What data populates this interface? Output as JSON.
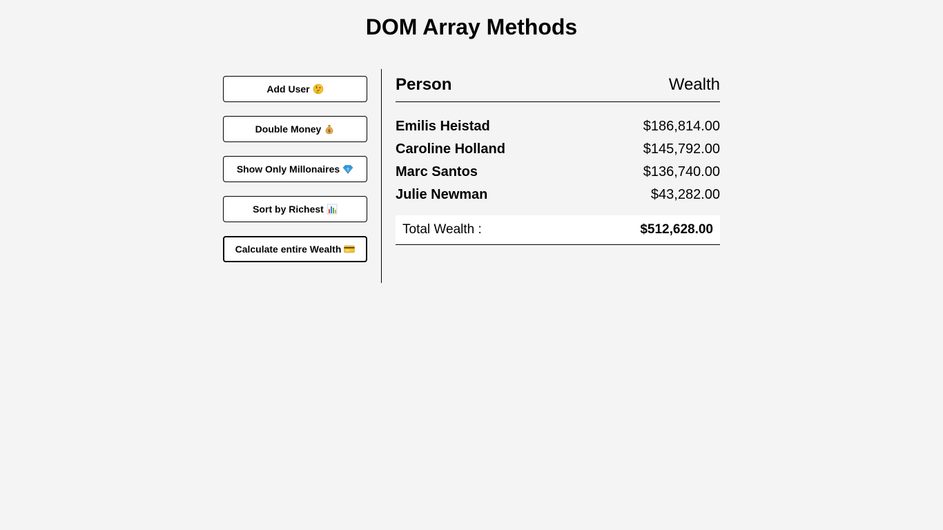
{
  "title": "DOM Array Methods",
  "buttons": [
    {
      "label": "Add User",
      "icon": "thinking-face-icon"
    },
    {
      "label": "Double Money",
      "icon": "money-bag-icon"
    },
    {
      "label": "Show Only Millonaires",
      "icon": "gem-icon"
    },
    {
      "label": "Sort by Richest",
      "icon": "bar-chart-icon"
    },
    {
      "label": "Calculate entire Wealth",
      "icon": "credit-card-icon"
    }
  ],
  "table": {
    "header_person": "Person",
    "header_wealth": "Wealth",
    "rows": [
      {
        "name": "Emilis Heistad",
        "wealth": "$186,814.00"
      },
      {
        "name": "Caroline Holland",
        "wealth": "$145,792.00"
      },
      {
        "name": "Marc Santos",
        "wealth": "$136,740.00"
      },
      {
        "name": "Julie Newman",
        "wealth": "$43,282.00"
      }
    ],
    "total_label": "Total Wealth :",
    "total_value": "$512,628.00"
  }
}
